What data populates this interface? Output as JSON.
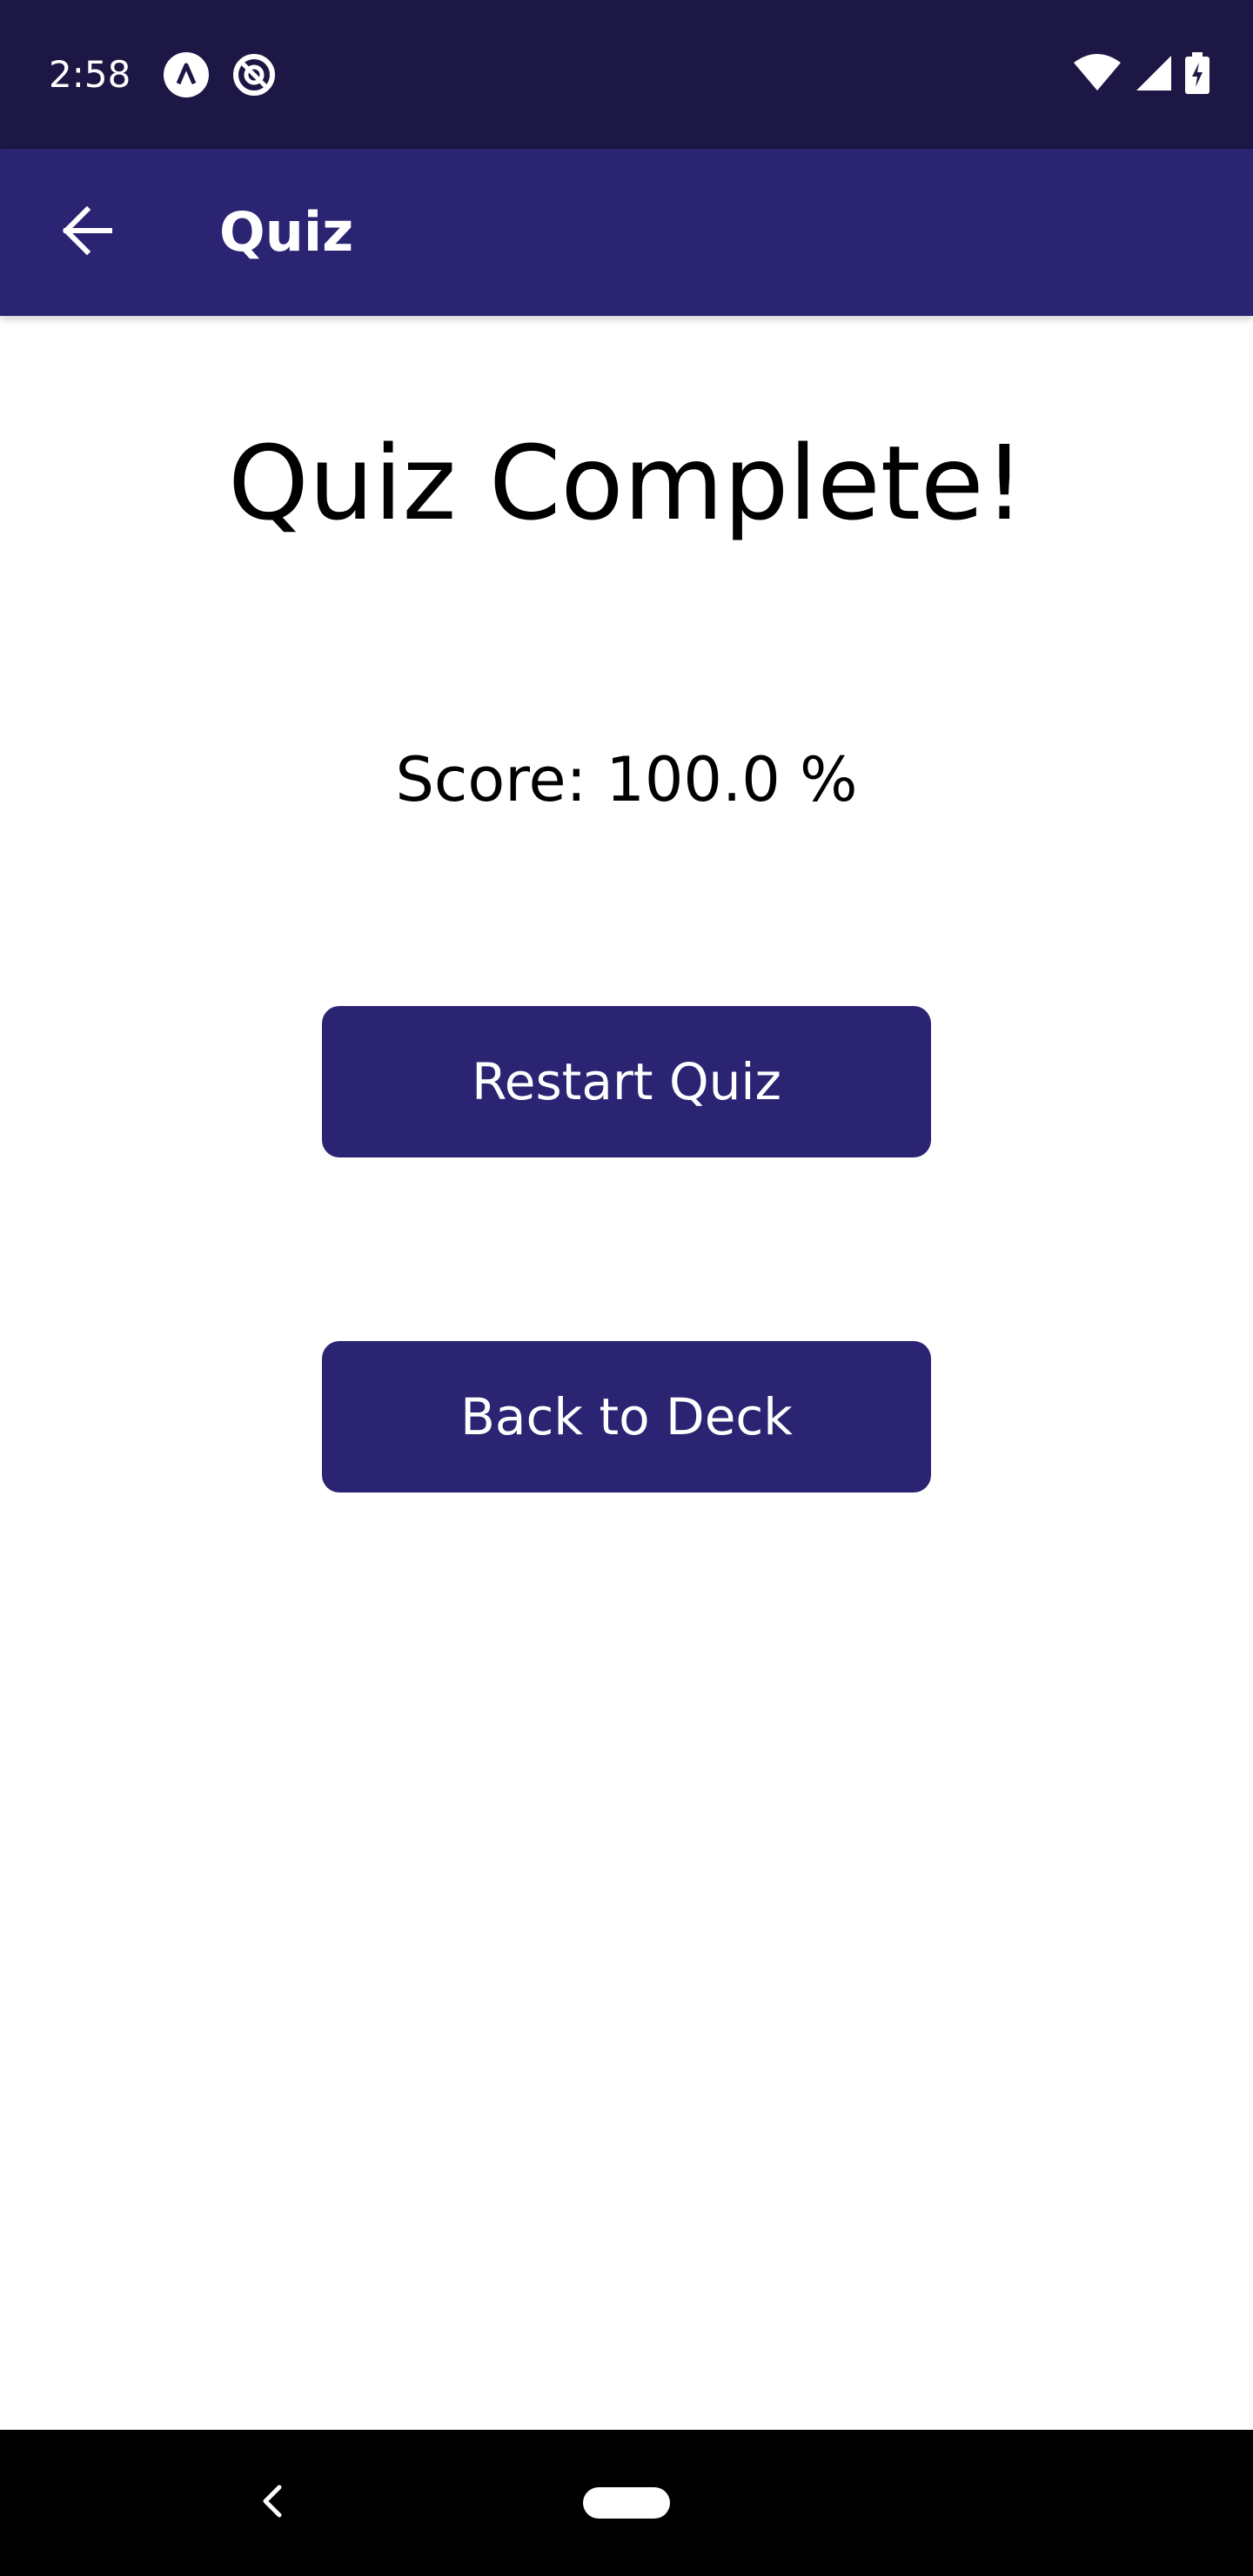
{
  "status_bar": {
    "time": "2:58",
    "icons": [
      "app-notification-icon",
      "no-disturb-icon",
      "wifi-icon",
      "signal-icon",
      "battery-charging-icon"
    ],
    "background": "#1c1744"
  },
  "app_bar": {
    "title": "Quiz",
    "back_icon": "arrow-left-icon",
    "background": "#2a2473"
  },
  "main": {
    "heading": "Quiz Complete!",
    "score": "Score: 100.0 %"
  },
  "buttons": {
    "restart_label": "Restart Quiz",
    "back_to_deck_label": "Back to Deck",
    "color": "#2a2473"
  },
  "nav_bar": {
    "back_icon": "chevron-left-icon",
    "home_icon": "home-pill-icon"
  }
}
